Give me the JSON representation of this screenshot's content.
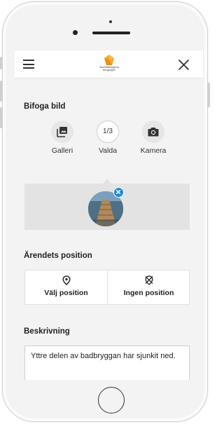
{
  "header": {
    "logo_line1": "Samhällsbyggnad",
    "logo_line2": "Bergslagen",
    "menu_icon": "hamburger-menu-icon",
    "close_icon": "close-icon",
    "logo_color": "#f5a623"
  },
  "attach": {
    "title": "Bifoga bild",
    "options": [
      {
        "label": "Galleri",
        "icon": "gallery-icon"
      },
      {
        "label": "Valda",
        "count": "1/3"
      },
      {
        "label": "Kamera",
        "icon": "camera-icon"
      }
    ],
    "remove_icon": "remove-photo-icon",
    "remove_color": "#1e88d8"
  },
  "position": {
    "title": "Ärendets position",
    "options": [
      {
        "label": "Välj position",
        "icon": "location-pin-icon"
      },
      {
        "label": "Ingen position",
        "icon": "no-location-icon"
      }
    ]
  },
  "description": {
    "title": "Beskrivning",
    "value": "Yttre delen av badbryggan har sjunkit ned."
  }
}
